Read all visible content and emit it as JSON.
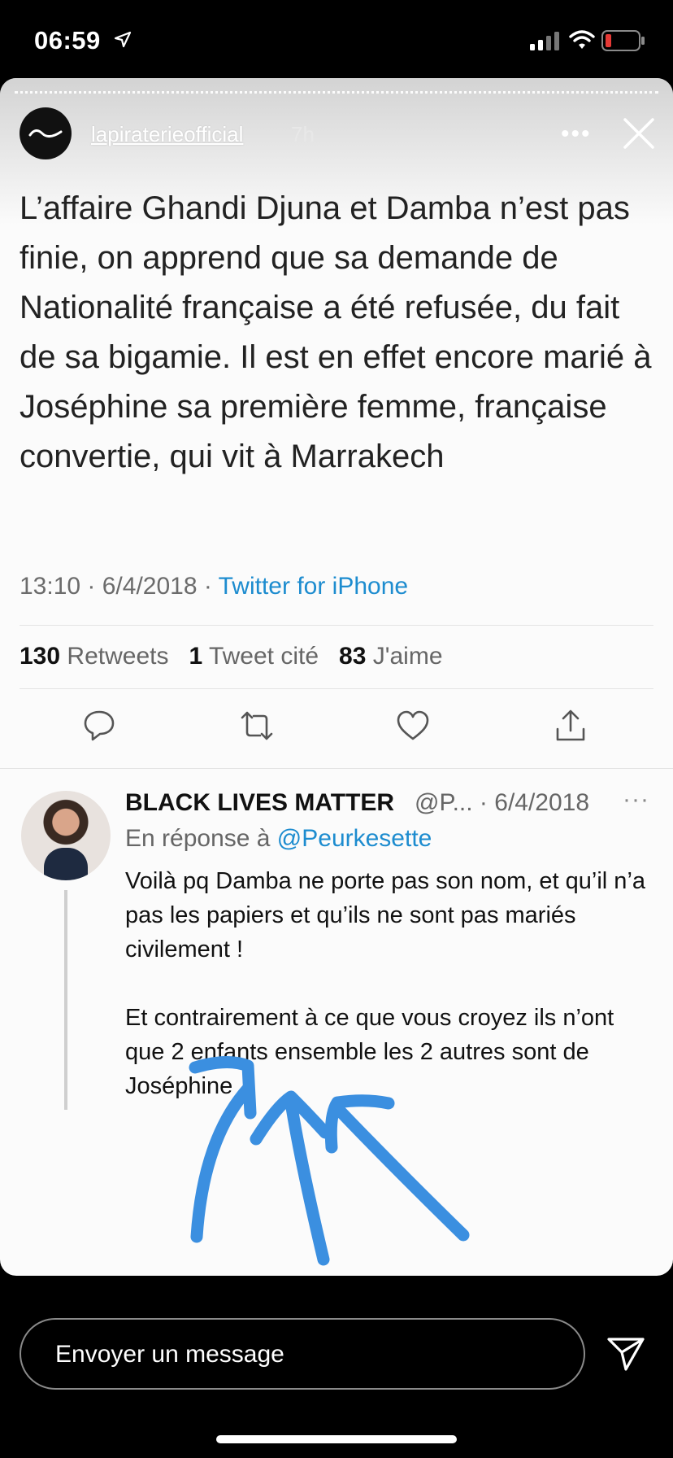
{
  "status_bar": {
    "time": "06:59"
  },
  "story": {
    "username": "lapiraterieofficial",
    "posted_ago": "7h",
    "more_label": "•••",
    "tweet": {
      "text": "L’affaire Ghandi Djuna et Damba n’est pas finie, on apprend que sa demande de Nationalité française a été refusée, du fait de sa bigamie. Il est en effet encore marié à Joséphine sa première femme, française convertie, qui vit à Marrakech",
      "time": "13:10 · 6/4/2018 · ",
      "source": "Twitter for iPhone",
      "stats": {
        "retweets_count": "130",
        "retweets_label": "Retweets",
        "quotes_count": "1",
        "quotes_label": "Tweet cité",
        "likes_count": "83",
        "likes_label": "J'aime"
      }
    },
    "reply": {
      "name": "BLACK LIVES MATTER",
      "handle_date": "@P... · 6/4/2018",
      "more_label": "···",
      "in_reply_prefix": "En réponse à ",
      "in_reply_mention": "@Peurkesette",
      "paragraph1": "Voilà pq Damba ne porte pas son nom, et qu’il n’a pas les papiers et qu’ils ne sont pas mariés civilement !",
      "paragraph2": "Et contrairement à ce que vous croyez ils n’ont que 2 enfants ensemble les 2 autres sont de Joséphine"
    }
  },
  "message_bar": {
    "placeholder": "Envoyer un message"
  },
  "colors": {
    "link_blue": "#1d8ccf",
    "arrow_blue": "#3b8fe0",
    "battery_red": "#e53935"
  }
}
